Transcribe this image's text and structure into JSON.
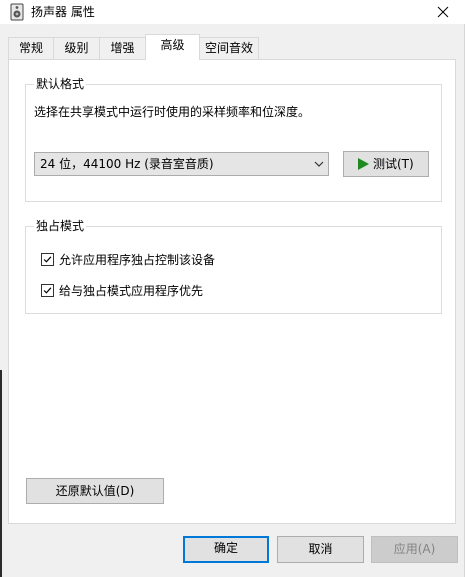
{
  "window": {
    "title": "扬声器 属性",
    "icon": "speaker-icon",
    "close": "close-icon"
  },
  "tabs": [
    {
      "label": "常规",
      "active": false
    },
    {
      "label": "级别",
      "active": false
    },
    {
      "label": "增强",
      "active": false
    },
    {
      "label": "高级",
      "active": true
    },
    {
      "label": "空间音效",
      "active": false
    }
  ],
  "default_format": {
    "title": "默认格式",
    "description": "选择在共享模式中运行时使用的采样频率和位深度。",
    "selected": "24 位，44100 Hz (录音室音质)",
    "dropdown_icon": "chevron-down-icon",
    "test_icon": "play-icon",
    "test_label": "测试(T)"
  },
  "exclusive_mode": {
    "title": "独占模式",
    "options": [
      {
        "label": "允许应用程序独占控制该设备",
        "checked": true
      },
      {
        "label": "给与独占模式应用程序优先",
        "checked": true
      }
    ]
  },
  "restore_defaults_label": "还原默认值(D)",
  "footer": {
    "ok": "确定",
    "cancel": "取消",
    "apply": "应用(A)"
  },
  "colors": {
    "accent": "#0078d7",
    "play": "#1f8a1f"
  }
}
